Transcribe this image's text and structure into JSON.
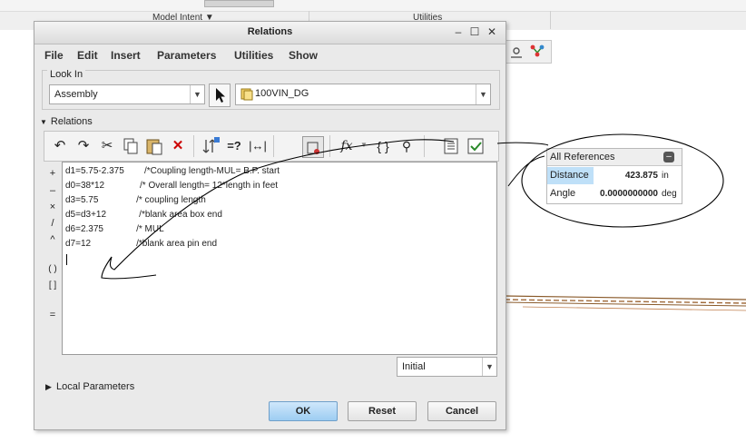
{
  "background": {
    "ribbon_groups": [
      "Model Intent ▼",
      "Utilities"
    ]
  },
  "dialog": {
    "title": "Relations",
    "controls": {
      "minimize": "–",
      "maximize": "☐",
      "close": "✕"
    },
    "menu": [
      "File",
      "Edit",
      "Insert",
      "Parameters",
      "Utilities",
      "Show"
    ],
    "look_in": {
      "label": "Look In",
      "type_value": "Assembly",
      "object_value": "100VIN_DG"
    },
    "relations_label": "Relations",
    "side_buttons": [
      "+",
      "–",
      "×",
      "/",
      "^",
      "( )",
      "[ ]",
      "="
    ],
    "code_lines": [
      "d1=5.75-2.375        /*Coupling length-MUL= B.P. start",
      "d0=38*12              /* Overall length= 12*length in feet",
      "d3=5.75               /* coupling length",
      "d5=d3+12             /*blank area box end",
      "d6=2.375             /* MUL",
      "d7=12                  /*blank area pin end"
    ],
    "state_value": "Initial",
    "local_parameters_label": "Local Parameters",
    "buttons": {
      "ok": "OK",
      "reset": "Reset",
      "cancel": "Cancel"
    }
  },
  "all_references": {
    "title": "All References",
    "close": "–",
    "rows": [
      {
        "label": "Distance",
        "value": "423.875",
        "unit": "in"
      },
      {
        "label": "Angle",
        "value": "0.0000000000",
        "unit": "deg"
      }
    ]
  },
  "colors": {
    "ok_button": "#9dcdf2",
    "highlight_row": "#bfe0f8",
    "annotation_ink": "#000000"
  }
}
